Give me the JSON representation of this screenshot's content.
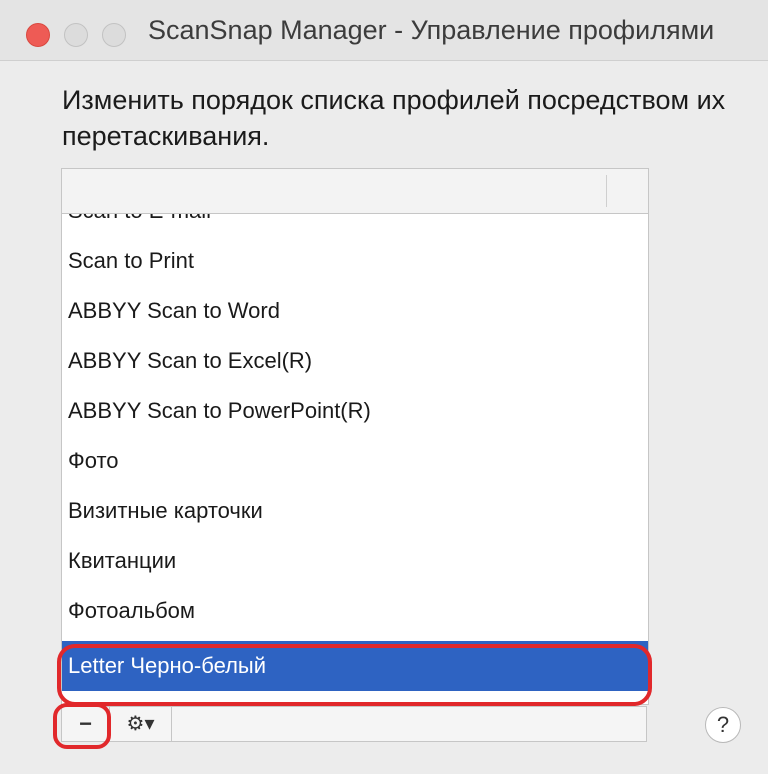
{
  "window": {
    "title": "ScanSnap Manager - Управление профилями",
    "controls": [
      "close",
      "minimize",
      "maximize"
    ]
  },
  "instructions": "Изменить порядок списка профилей посредством их перетаскивания.",
  "profiles": [
    {
      "label": "Scan to E-mail",
      "selected": false
    },
    {
      "label": "Scan to Print",
      "selected": false
    },
    {
      "label": "ABBYY Scan to Word",
      "selected": false
    },
    {
      "label": "ABBYY Scan to Excel(R)",
      "selected": false
    },
    {
      "label": "ABBYY Scan to PowerPoint(R)",
      "selected": false
    },
    {
      "label": "Фото",
      "selected": false
    },
    {
      "label": "Визитные карточки",
      "selected": false
    },
    {
      "label": "Квитанции",
      "selected": false
    },
    {
      "label": "Фотоальбом",
      "selected": false
    },
    {
      "label": "Letter Черно-белый",
      "selected": true
    }
  ],
  "toolbar": {
    "remove_icon": "minus-icon",
    "remove_glyph": "−",
    "action_icon": "gear-icon",
    "action_glyph": "⚙▾"
  },
  "help": {
    "glyph": "?"
  },
  "colors": {
    "selection": "#2e63c2",
    "annotation": "#e1282b",
    "close_button": "#ee5b55"
  }
}
